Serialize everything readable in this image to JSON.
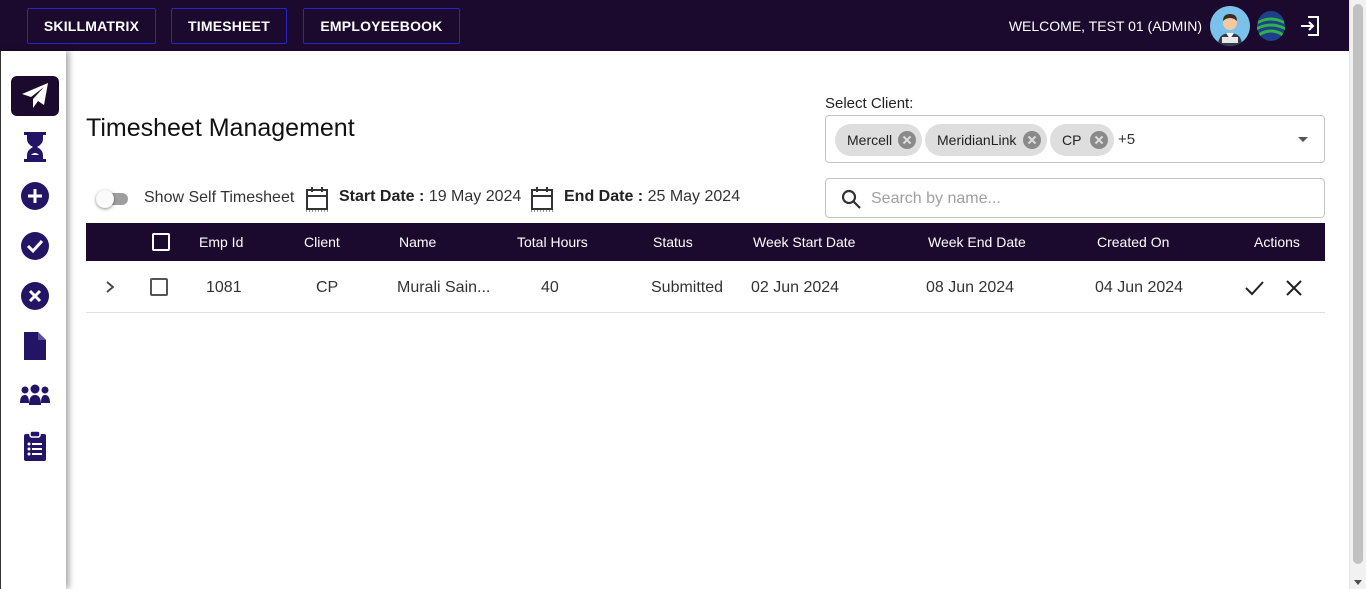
{
  "nav": {
    "skillmatrix": "SKILLMATRIX",
    "timesheet": "TIMESHEET",
    "employeebook": "EMPLOYEEBOOK"
  },
  "header": {
    "welcome": "WELCOME, TEST 01 (ADMIN)"
  },
  "sidebar": {
    "items": [
      {
        "icon": "paper-plane-icon",
        "active": true
      },
      {
        "icon": "hourglass-icon"
      },
      {
        "icon": "plus-circle-icon"
      },
      {
        "icon": "check-circle-icon"
      },
      {
        "icon": "x-circle-icon"
      },
      {
        "icon": "file-icon"
      },
      {
        "icon": "users-icon"
      },
      {
        "icon": "clipboard-list-icon"
      }
    ]
  },
  "page": {
    "title": "Timesheet Management"
  },
  "client_select": {
    "label": "Select Client:",
    "chips": [
      "Mercell",
      "MeridianLink",
      "CP"
    ],
    "more": "+5"
  },
  "filters": {
    "self_toggle_label": "Show Self Timesheet",
    "self_toggle_on": false,
    "start_label": "Start Date :",
    "start_value": "19 May 2024",
    "end_label": "End Date :",
    "end_value": "25 May 2024"
  },
  "search": {
    "placeholder": "Search by name..."
  },
  "table": {
    "columns": [
      "Emp Id",
      "Client",
      "Name",
      "Total Hours",
      "Status",
      "Week Start Date",
      "Week End Date",
      "Created On",
      "Actions"
    ],
    "rows": [
      {
        "emp_id": "1081",
        "client": "CP",
        "name": "Murali Sain...",
        "total_hours": "40",
        "status": "Submitted",
        "week_start": "02 Jun 2024",
        "week_end": "08 Jun 2024",
        "created_on": "04 Jun 2024"
      }
    ]
  },
  "colors": {
    "primary": "#1c0a2e",
    "icon": "#241466",
    "nav_border": "#2a25c9"
  }
}
